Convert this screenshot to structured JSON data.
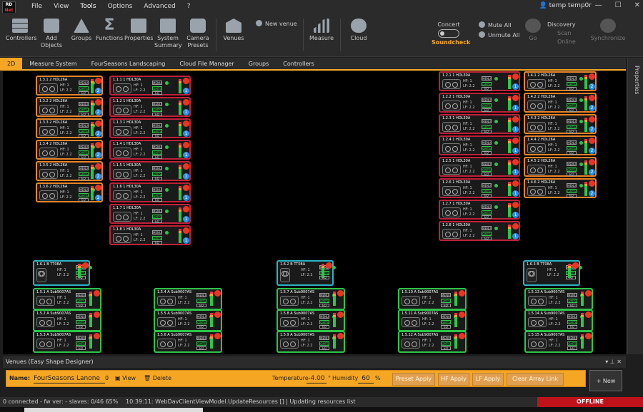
{
  "app": {
    "logo_top": "RD",
    "logo_bottom": "Net",
    "user": "temp temp0r"
  },
  "menu": [
    "File",
    "View",
    "Tools",
    "Options",
    "Advanced",
    "?"
  ],
  "ribbon": {
    "controllers": "Controllers",
    "add_objects": "Add\nObjects",
    "groups": "Groups",
    "functions": "Functions",
    "properties": "Properties",
    "system_summary": "System\nSummary",
    "camera_presets": "Camera\nPresets",
    "venues": "Venues",
    "new_venue": "New venue",
    "measure": "Measure",
    "cloud": "Cloud",
    "concert": "Concert",
    "soundcheck": "Soundcheck",
    "mute_all": "Mute All",
    "unmute_all": "Unmute All",
    "go": "Go",
    "discovery": "Discovery",
    "scan": "Scan",
    "online": "Online",
    "synchronize": "Synchronize"
  },
  "tabs": [
    "2D",
    "Measure System",
    "FourSeasons Landscaping",
    "Cloud File Manager",
    "Groups",
    "Controllers"
  ],
  "side_panel": "Properties",
  "devices": {
    "left_col1": [
      "1.3.1 2 HDL26A",
      "1.3.2 2 HDL26A",
      "1.3.3 2 HDL26A",
      "1.3.4 2 HDL26A",
      "1.3.5 2 HDL26A",
      "1.3.6 2 HDL26A"
    ],
    "left_col2": [
      "1.1.1 1 HDL30A",
      "1.1.2 1 HDL30A",
      "1.1.3 1 HDL30A",
      "1.1.4 1 HDL30A",
      "1.1.5 1 HDL30A",
      "1.1.6 1 HDL30A",
      "1.1.7 1 HDL30A",
      "1.1.8 1 HDL30A"
    ],
    "right_col1": [
      "1.2.1 1 HDL30A",
      "1.2.2 1 HDL30A",
      "1.2.3 1 HDL30A",
      "1.2.4 1 HDL30A",
      "1.2.5 1 HDL30A",
      "1.2.6 1 HDL30A",
      "1.2.7 1 HDL30A",
      "1.2.8 1 HDL30A"
    ],
    "right_col2": [
      "1.4.1 2 HDL26A",
      "1.4.2 2 HDL26A",
      "1.4.3 2 HDL26A",
      "1.4.4 2 HDL26A",
      "1.4.5 2 HDL26A",
      "1.4.6 2 HDL26A"
    ],
    "tops": [
      "1.6.1 B TT08A",
      "1.6.2 B TT08A",
      "1.6.3 B TT08A"
    ],
    "subs": [
      [
        "1.5.1 A Sub9007AS",
        "1.5.2 A Sub9007AS",
        "1.5.3 A Sub9007AS"
      ],
      [
        "1.5.4 A Sub9007AS",
        "1.5.5 A Sub9007AS",
        "1.5.6 A Sub9007AS"
      ],
      [
        "1.5.7 A Sub9007AS",
        "1.5.8 A Sub9007AS",
        "1.5.9 A Sub9007AS"
      ],
      [
        "1.5.10 A Sub9007AS",
        "1.5.11 A Sub9007AS",
        "1.5.12 A Sub9007AS"
      ],
      [
        "1.5.13 A Sub9007AS",
        "1.5.14 A Sub9007AS",
        "1.5.15 A Sub9007AS"
      ]
    ],
    "gain_hf": "HF: 1",
    "gain_lf": "LF: 2.2",
    "menu": "MENU",
    "gmts": "GMTS",
    "eq": "EQ"
  },
  "venues": {
    "header": "Venues (Easy Shape Designer)",
    "name_label": "Name:",
    "name_value": "FourSeasons Lanone",
    "count": "0",
    "view": "View",
    "delete": "Delete",
    "temp_label": "Temperature",
    "temp_value": "-4.00",
    "temp_unit": "°",
    "humidity_label": "Humidity",
    "humidity_value": "60",
    "humidity_unit": "%",
    "preset_apply": "Preset Apply",
    "hf_apply": "HF Apply",
    "lf_apply": "LF Apply",
    "clear_array_link": "Clear Array Link",
    "new": "New"
  },
  "status": {
    "left": "0 connected  - fw ver:  - slaves:  0/46  65%",
    "log": "10:39:11: WebDavClientViewModel.UpdateResources [] | Updating resources list",
    "offline": "OFFLINE"
  }
}
